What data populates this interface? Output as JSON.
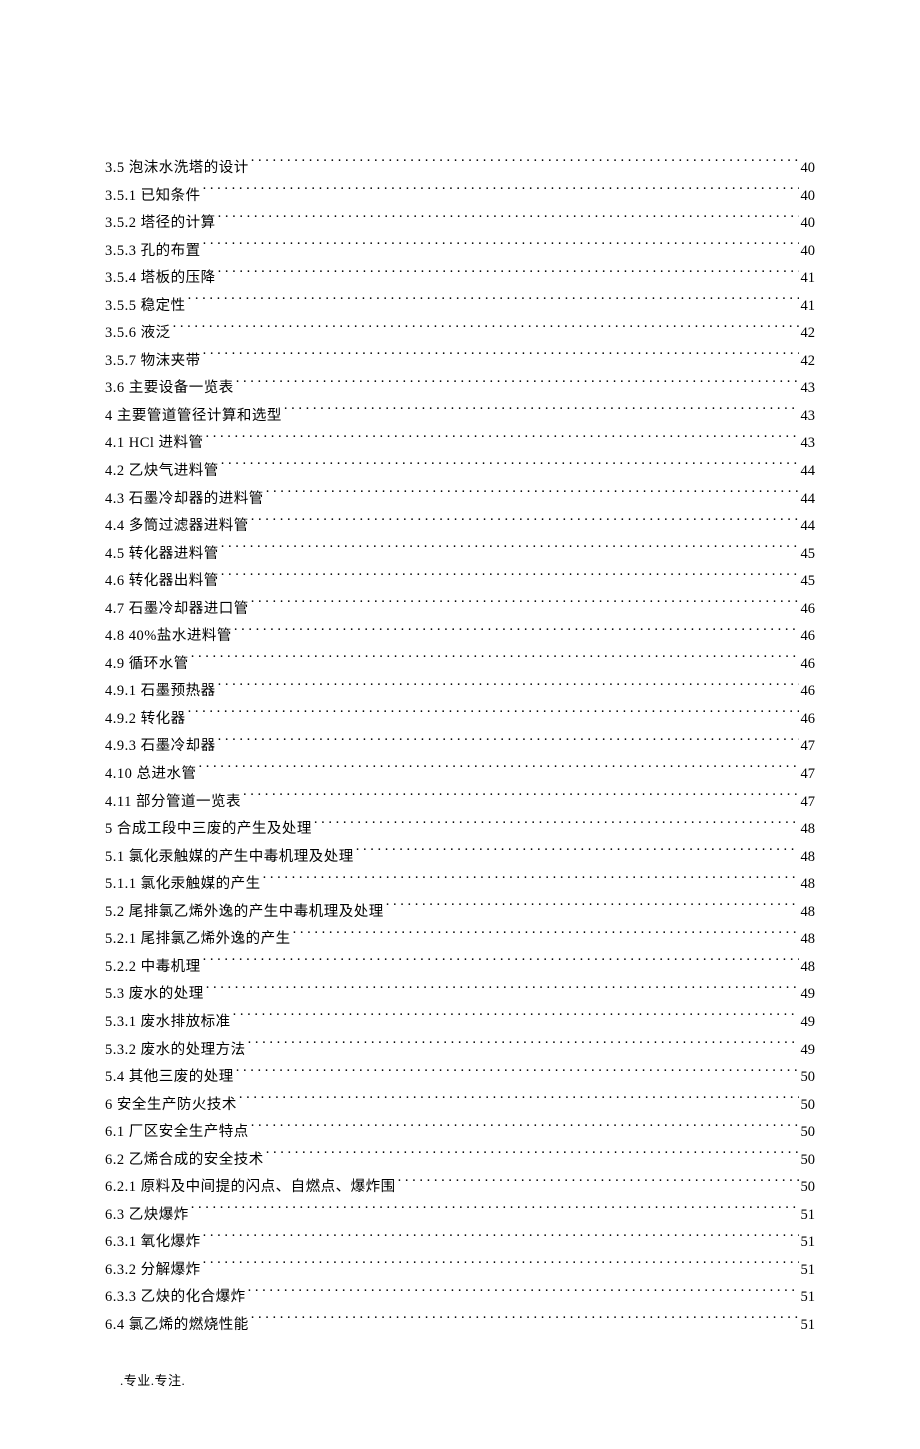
{
  "toc": [
    {
      "label": "3.5 泡沫水洗塔的设计",
      "page": "40"
    },
    {
      "label": "3.5.1 已知条件",
      "page": "40"
    },
    {
      "label": "3.5.2 塔径的计算",
      "page": "40"
    },
    {
      "label": "3.5.3 孔的布置",
      "page": "40"
    },
    {
      "label": "3.5.4 塔板的压降",
      "page": "41"
    },
    {
      "label": "3.5.5 稳定性",
      "page": "41"
    },
    {
      "label": "3.5.6 液泛",
      "page": "42"
    },
    {
      "label": "3.5.7 物沫夹带",
      "page": "42"
    },
    {
      "label": "3.6 主要设备一览表",
      "page": "43"
    },
    {
      "label": "4 主要管道管径计算和选型",
      "page": "43"
    },
    {
      "label": "4.1 HCl 进料管",
      "page": "43"
    },
    {
      "label": "4.2 乙炔气进料管",
      "page": "44"
    },
    {
      "label": "4.3 石墨冷却器的进料管",
      "page": "44"
    },
    {
      "label": "4.4 多筒过滤器进料管",
      "page": "44"
    },
    {
      "label": "4.5 转化器进料管",
      "page": "45"
    },
    {
      "label": "4.6 转化器出料管",
      "page": "45"
    },
    {
      "label": "4.7 石墨冷却器进口管",
      "page": "46"
    },
    {
      "label": "4.8  40%盐水进料管",
      "page": "46"
    },
    {
      "label": "4.9 循环水管",
      "page": "46"
    },
    {
      "label": "4.9.1 石墨预热器",
      "page": "46"
    },
    {
      "label": "4.9.2 转化器",
      "page": "46"
    },
    {
      "label": "4.9.3 石墨冷却器",
      "page": "47"
    },
    {
      "label": "4.10 总进水管",
      "page": "47"
    },
    {
      "label": "4.11 部分管道一览表",
      "page": "47"
    },
    {
      "label": "5 合成工段中三废的产生及处理",
      "page": "48"
    },
    {
      "label": "5.1 氯化汞触媒的产生中毒机理及处理",
      "page": "48"
    },
    {
      "label": "5.1.1 氯化汞触媒的产生",
      "page": "48"
    },
    {
      "label": "5.2 尾排氯乙烯外逸的产生中毒机理及处理",
      "page": "48"
    },
    {
      "label": "5.2.1 尾排氯乙烯外逸的产生",
      "page": "48"
    },
    {
      "label": "5.2.2 中毒机理",
      "page": "48"
    },
    {
      "label": "5.3 废水的处理",
      "page": "49"
    },
    {
      "label": "5.3.1 废水排放标准",
      "page": "49"
    },
    {
      "label": "5.3.2 废水的处理方法",
      "page": "49"
    },
    {
      "label": "5.4 其他三废的处理",
      "page": "50"
    },
    {
      "label": "6 安全生产防火技术",
      "page": "50"
    },
    {
      "label": "6.1 厂区安全生产特点",
      "page": "50"
    },
    {
      "label": "6.2 乙烯合成的安全技术",
      "page": "50"
    },
    {
      "label": "6.2.1 原料及中间提的闪点、自燃点、爆炸围",
      "page": "50"
    },
    {
      "label": "6.3 乙炔爆炸",
      "page": "51"
    },
    {
      "label": "6.3.1 氧化爆炸",
      "page": "51"
    },
    {
      "label": "6.3.2 分解爆炸",
      "page": "51"
    },
    {
      "label": "6.3.3 乙炔的化合爆炸",
      "page": "51"
    },
    {
      "label": "6.4 氯乙烯的燃烧性能",
      "page": "51"
    }
  ],
  "footer": ".专业.专注."
}
